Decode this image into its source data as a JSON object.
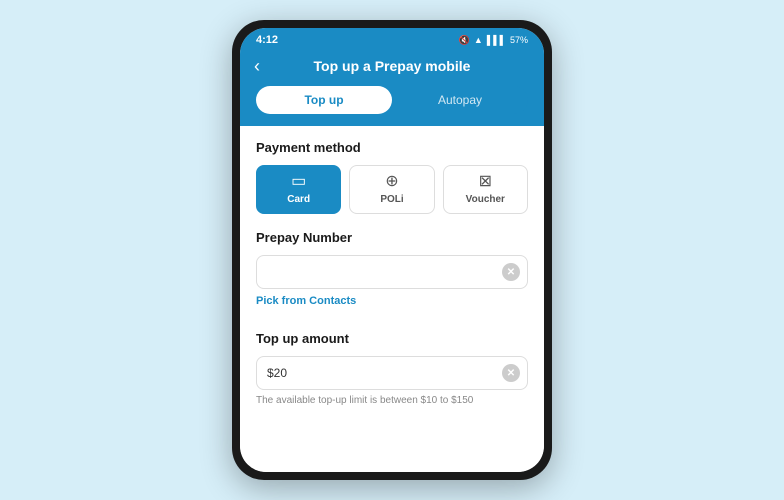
{
  "statusBar": {
    "time": "4:12",
    "battery": "57%"
  },
  "header": {
    "title": "Top up a Prepay mobile",
    "backLabel": "‹"
  },
  "tabs": [
    {
      "id": "topup",
      "label": "Top up",
      "active": true
    },
    {
      "id": "autopay",
      "label": "Autopay",
      "active": false
    }
  ],
  "paymentMethod": {
    "sectionLabel": "Payment method",
    "options": [
      {
        "id": "card",
        "label": "Card",
        "icon": "▭",
        "active": true
      },
      {
        "id": "poli",
        "label": "POLi",
        "icon": "⊕",
        "active": false
      },
      {
        "id": "voucher",
        "label": "Voucher",
        "icon": "⊠",
        "active": false
      }
    ]
  },
  "prepayNumber": {
    "sectionLabel": "Prepay Number",
    "placeholder": "",
    "value": "",
    "pickFromContacts": "Pick from Contacts"
  },
  "topUpAmount": {
    "sectionLabel": "Top up amount",
    "value": "$20",
    "hint": "The available top-up limit is between $10 to $150"
  },
  "colors": {
    "primary": "#1a8bc4",
    "activeTab": "#ffffff"
  }
}
